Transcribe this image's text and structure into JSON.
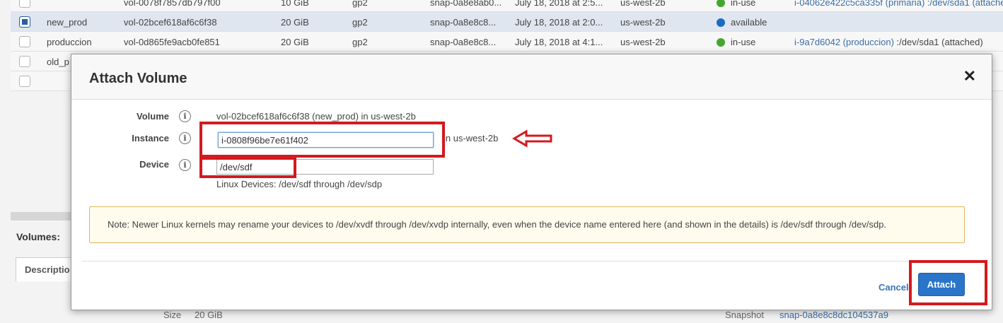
{
  "table": {
    "rows": [
      {
        "name": "",
        "volume_id": "vol-0078f7857db797f00",
        "size": "10 GiB",
        "type": "gp2",
        "snapshot": "snap-0a8e8ab0...",
        "created": "July 18, 2018 at 2:5...",
        "zone": "us-west-2b",
        "state": "in-use",
        "attachment": "i-04062e422c5ca335f (primaria) :/dev/sda1 (attache"
      },
      {
        "name": "new_prod",
        "volume_id": "vol-02bcef618af6c6f38",
        "size": "20 GiB",
        "type": "gp2",
        "snapshot": "snap-0a8e8c8...",
        "created": "July 18, 2018 at 2:0...",
        "zone": "us-west-2b",
        "state": "available",
        "attachment": ""
      },
      {
        "name": "produccion",
        "volume_id": "vol-0d865fe9acb0fe851",
        "size": "20 GiB",
        "type": "gp2",
        "snapshot": "snap-0a8e8c8...",
        "created": "July 18, 2018 at 4:1...",
        "zone": "us-west-2b",
        "state": "in-use",
        "attachment_link": "i-9a7d6042 (produccion)",
        "attachment_rest": " :/dev/sda1 (attached)"
      },
      {
        "name": "old_p",
        "volume_id": "",
        "size": "",
        "type": "",
        "snapshot": "",
        "created": "",
        "zone": "",
        "state": "",
        "attachment": ""
      },
      {
        "name": "",
        "volume_id": "",
        "size": "",
        "type": "",
        "snapshot": "",
        "created": "",
        "zone": "",
        "state": "",
        "attachment": ""
      }
    ],
    "status_colors": {
      "in_use": "#43a72d",
      "available": "#1a6bc4"
    }
  },
  "background": {
    "volumes_label": "Volumes:",
    "description_tab": "Descriptio",
    "size_label": "Size",
    "size_value": "20 GiB",
    "snapshot_label": "Snapshot",
    "snapshot_value": "snap-0a8e8c8dc104537a9"
  },
  "modal": {
    "title": "Attach Volume",
    "close_symbol": "✕",
    "volume_label": "Volume",
    "volume_value": "vol-02bcef618af6c6f38 (new_prod) in us-west-2b",
    "instance_label": "Instance",
    "instance_value": "i-0808f96be7e61f402",
    "instance_suffix": "in us-west-2b",
    "device_label": "Device",
    "device_value": "/dev/sdf",
    "device_hint": "Linux Devices: /dev/sdf through /dev/sdp",
    "info_symbol": "i",
    "note": "Note: Newer Linux kernels may rename your devices to /dev/xvdf through /dev/xvdp internally, even when the device name entered here (and shown in the details) is /dev/sdf through /dev/sdp.",
    "cancel_label": "Cancel",
    "attach_label": "Attach",
    "annotation_color": "#d4191f"
  }
}
